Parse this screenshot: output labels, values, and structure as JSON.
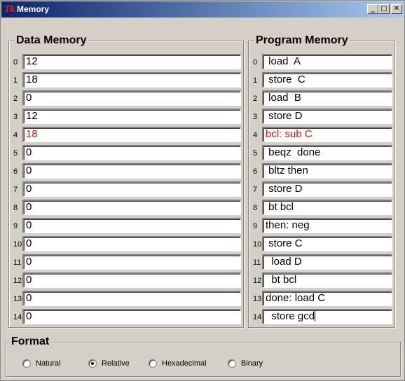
{
  "window": {
    "title": "Memory",
    "logo_text": "Tk"
  },
  "data_memory": {
    "title": "Data Memory",
    "rows": [
      {
        "index": "0",
        "value": "12"
      },
      {
        "index": "1",
        "value": "18"
      },
      {
        "index": "2",
        "value": "0"
      },
      {
        "index": "3",
        "value": "12"
      },
      {
        "index": "4",
        "value": "18",
        "highlighted": true
      },
      {
        "index": "5",
        "value": "0"
      },
      {
        "index": "6",
        "value": "0"
      },
      {
        "index": "7",
        "value": "0"
      },
      {
        "index": "8",
        "value": "0"
      },
      {
        "index": "9",
        "value": "0"
      },
      {
        "index": "10",
        "value": "0"
      },
      {
        "index": "11",
        "value": "0"
      },
      {
        "index": "12",
        "value": "0"
      },
      {
        "index": "13",
        "value": "0"
      },
      {
        "index": "14",
        "value": "0"
      }
    ]
  },
  "program_memory": {
    "title": "Program Memory",
    "rows": [
      {
        "index": "0",
        "value": " load  A"
      },
      {
        "index": "1",
        "value": " store  C"
      },
      {
        "index": "2",
        "value": " load  B"
      },
      {
        "index": "3",
        "value": " store D"
      },
      {
        "index": "4",
        "value": "bcl: sub C",
        "highlighted": true
      },
      {
        "index": "5",
        "value": " beqz  done"
      },
      {
        "index": "6",
        "value": " bltz then"
      },
      {
        "index": "7",
        "value": " store D"
      },
      {
        "index": "8",
        "value": " bt bcl"
      },
      {
        "index": "9",
        "value": "then: neg"
      },
      {
        "index": "10",
        "value": " store C"
      },
      {
        "index": "11",
        "value": "  load D"
      },
      {
        "index": "12",
        "value": "  bt bcl"
      },
      {
        "index": "13",
        "value": "done: load C"
      },
      {
        "index": "14",
        "value": "  store gcd",
        "has_caret": true
      }
    ]
  },
  "format": {
    "title": "Format",
    "options": [
      "Natural",
      "Relative",
      "Hexadecimal",
      "Binary"
    ],
    "selected": "Relative"
  },
  "colors": {
    "highlight": "#d01010",
    "titlebar_start": "#0a246a",
    "titlebar_end": "#a6caf0"
  }
}
